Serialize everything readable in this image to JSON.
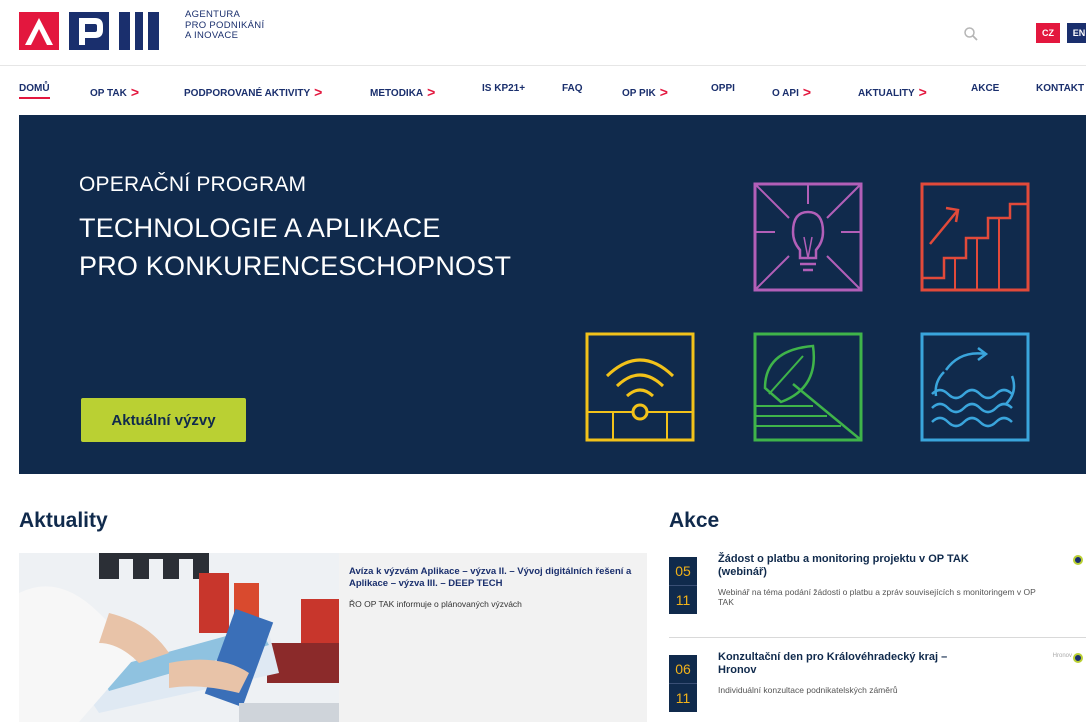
{
  "header": {
    "agency_lines": [
      "AGENTURA",
      "PRO PODNIKÁNÍ",
      "A INOVACE"
    ],
    "search_icon": "search-icon",
    "languages": [
      "CZ",
      "EN"
    ]
  },
  "nav": {
    "items": [
      {
        "label": "DOMŮ",
        "has_arrow": false,
        "active": true
      },
      {
        "label": "OP TAK",
        "has_arrow": true
      },
      {
        "label": "PODPOROVANÉ AKTIVITY",
        "has_arrow": true
      },
      {
        "label": "METODIKA",
        "has_arrow": true
      },
      {
        "label": "IS KP21+",
        "has_arrow": false
      },
      {
        "label": "FAQ",
        "has_arrow": false
      },
      {
        "label": "OP PIK",
        "has_arrow": true
      },
      {
        "label": "OPPI",
        "has_arrow": false
      },
      {
        "label": "O API",
        "has_arrow": true
      },
      {
        "label": "AKTUALITY",
        "has_arrow": true
      },
      {
        "label": "AKCE",
        "has_arrow": false
      },
      {
        "label": "KONTAKT",
        "has_arrow": false
      }
    ],
    "arrow_glyph": ">"
  },
  "hero": {
    "kicker": "OPERAČNÍ PROGRAM",
    "title_lines": [
      "TECHNOLOGIE A APLIKACE",
      "PRO KONKURENCESCHOPNOST"
    ],
    "cta_label": "Aktuální výzvy",
    "colors": {
      "bg": "#102a4c",
      "cta": "#bad033"
    }
  },
  "aktuality": {
    "heading": "Aktuality",
    "card": {
      "title": "Avíza k výzvám Aplikace – výzva II. – Vývoj digitálních řešení a Aplikace – výzva III. – DEEP TECH",
      "text": "ŘO OP TAK informuje o plánovaných výzvách"
    }
  },
  "akce": {
    "heading": "Akce",
    "events": [
      {
        "day": "05",
        "month": "11",
        "title": "Žádost o platbu a monitoring projektu v OP TAK (webinář)",
        "text": "Webinář na téma podání žádosti o platbu a zpráv souvisejících s monitoringem v OP TAK",
        "place": ""
      },
      {
        "day": "06",
        "month": "11",
        "title": "Konzultační den pro Královéhradecký kraj – Hronov",
        "text": "Individuální konzultace podnikatelských záměrů",
        "place": "Hronov"
      }
    ]
  }
}
